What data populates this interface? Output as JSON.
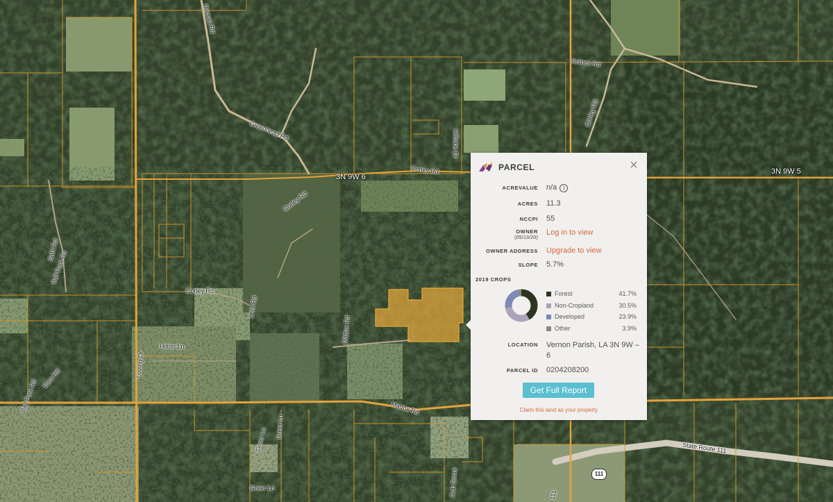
{
  "map": {
    "colors": {
      "parcel_line": "#d99a2b",
      "road": "#e6a23a",
      "highlight": "#e2a63a"
    },
    "road_labels": {
      "greenhead_rd": "Greenhead Rd",
      "dacraa_rd_top": "Dacraa Rd",
      "corley_rd_main": "Corley Rd",
      "jeanes_rd": "Jeanes Rd",
      "corley_rd_north": "Corley Rd",
      "hillside_dr": "Hillside Dr",
      "corley_rd_mid": "Corley Rd",
      "corley_rd_low": "Corley Rd",
      "sabi_rd": "Sabi Rd",
      "ball_park_rd": "Ball Park Rd",
      "ball_park_rd_low": "Ball Park Rd",
      "east_rd": "East Rd",
      "loving_dr": "Loving Dr",
      "hilton_ln": "Hilton Ln",
      "lehr_rd": "Lehr Rd",
      "mattox_rd": "Mattox Rd",
      "mattox_rd_south": "Mattox Rd",
      "greer_ln": "Greer Ln",
      "greer_ln_2": "Greer Ln",
      "greer_ln_3": "Greer Ln",
      "cub_scout": "Cub Scout",
      "state_route": "State Route 111",
      "route_111_partial": "111"
    },
    "township_labels": {
      "west": "3N 9W 6",
      "east": "3N 9W 5"
    },
    "shield_label": "111"
  },
  "popup": {
    "title": "PARCEL",
    "logo_icon": "acrevalue-logo-icon",
    "close_icon": "close-icon",
    "fields": {
      "acrevalue": {
        "label": "ACREVALUE",
        "value": "n/a",
        "info": "i"
      },
      "acres": {
        "label": "ACRES",
        "value": "11.3"
      },
      "nccpi": {
        "label": "NCCPI",
        "value": "55"
      },
      "owner": {
        "label": "OWNER",
        "sublabel": "(05/13/20)",
        "value": "Log in to view"
      },
      "owner_address": {
        "label": "OWNER ADDRESS",
        "value": "Upgrade to view"
      },
      "slope": {
        "label": "SLOPE",
        "value": "5.7%"
      },
      "location": {
        "label": "LOCATION",
        "value": "Vernon Parish, LA 3N 9W – 6"
      },
      "parcel_id": {
        "label": "PARCEL ID",
        "value": "0204208200"
      }
    },
    "crops_title": "2019 CROPS",
    "button_label": "Get Full Report",
    "claim_link": "Claim this land as your property"
  },
  "chart_data": {
    "type": "pie",
    "title": "2019 CROPS",
    "categories": [
      "Forest",
      "Non-Cropland",
      "Developed",
      "Other"
    ],
    "values": [
      41.7,
      30.5,
      23.9,
      3.9
    ],
    "labels": [
      "41.7%",
      "30.5%",
      "23.9%",
      "3.9%"
    ],
    "colors": [
      "#2d3520",
      "#aba3b7",
      "#7d89b6",
      "#8a8a82"
    ]
  }
}
